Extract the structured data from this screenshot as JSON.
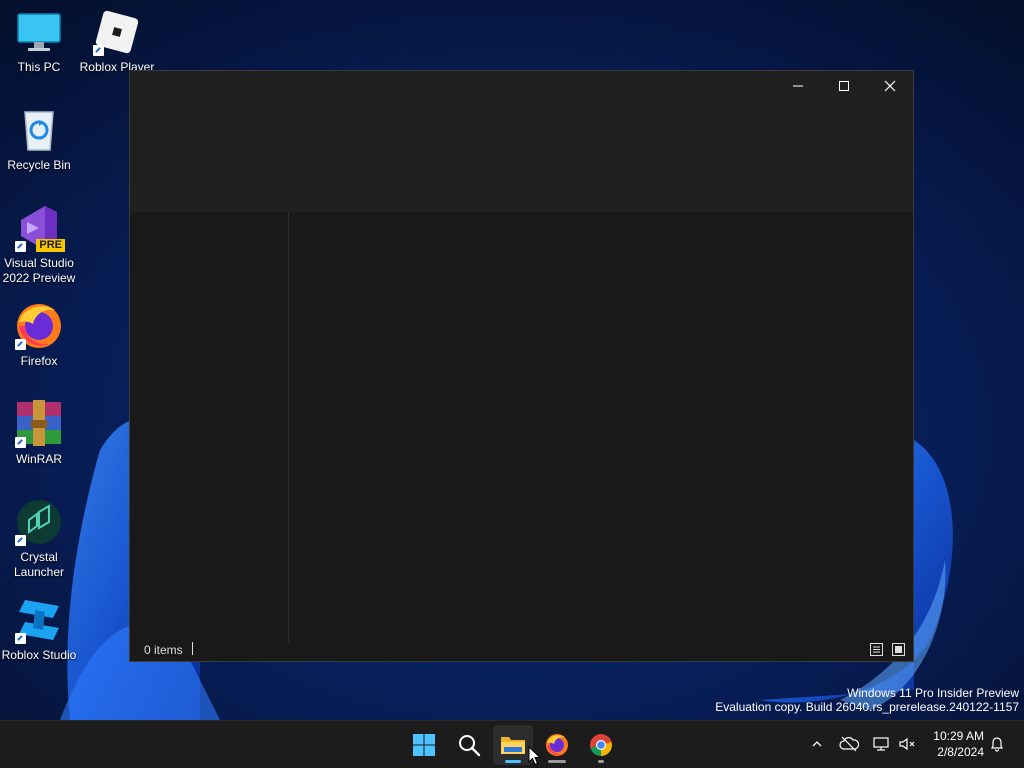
{
  "desktop": {
    "icons": [
      {
        "label": "This PC",
        "icon": "monitor-icon"
      },
      {
        "label": "Roblox Player",
        "icon": "roblox-player-icon"
      },
      {
        "label": "Recycle Bin",
        "icon": "recycle-bin-icon"
      },
      {
        "label": "Visual Studio 2022 Preview",
        "icon": "visual-studio-icon",
        "badge": "PRE"
      },
      {
        "label": "Firefox",
        "icon": "firefox-icon"
      },
      {
        "label": "WinRAR",
        "icon": "winrar-icon"
      },
      {
        "label": "Crystal Launcher",
        "icon": "crystal-launcher-icon"
      },
      {
        "label": "Roblox Studio",
        "icon": "roblox-studio-icon"
      }
    ],
    "watermark": {
      "line1": "Windows 11 Pro Insider Preview",
      "line2": "Evaluation copy. Build 26040.rs_prerelease.240122-1157"
    }
  },
  "explorer": {
    "status": {
      "items_count": "0 items"
    }
  },
  "taskbar": {
    "apps": [
      {
        "name": "Start",
        "icon": "windows-start-icon"
      },
      {
        "name": "Search",
        "icon": "search-icon"
      },
      {
        "name": "File Explorer",
        "icon": "folder-icon",
        "active": true
      },
      {
        "name": "Firefox",
        "icon": "firefox-icon",
        "running": true
      },
      {
        "name": "Google Chrome",
        "icon": "chrome-icon",
        "running": true
      }
    ],
    "clock": {
      "time": "10:29 AM",
      "date": "2/8/2024"
    }
  },
  "colors": {
    "taskbar_bg": "#1c1c1c",
    "window_bg": "#191919",
    "titlebar_bg": "#202020",
    "accent": "#4cc2ff"
  }
}
